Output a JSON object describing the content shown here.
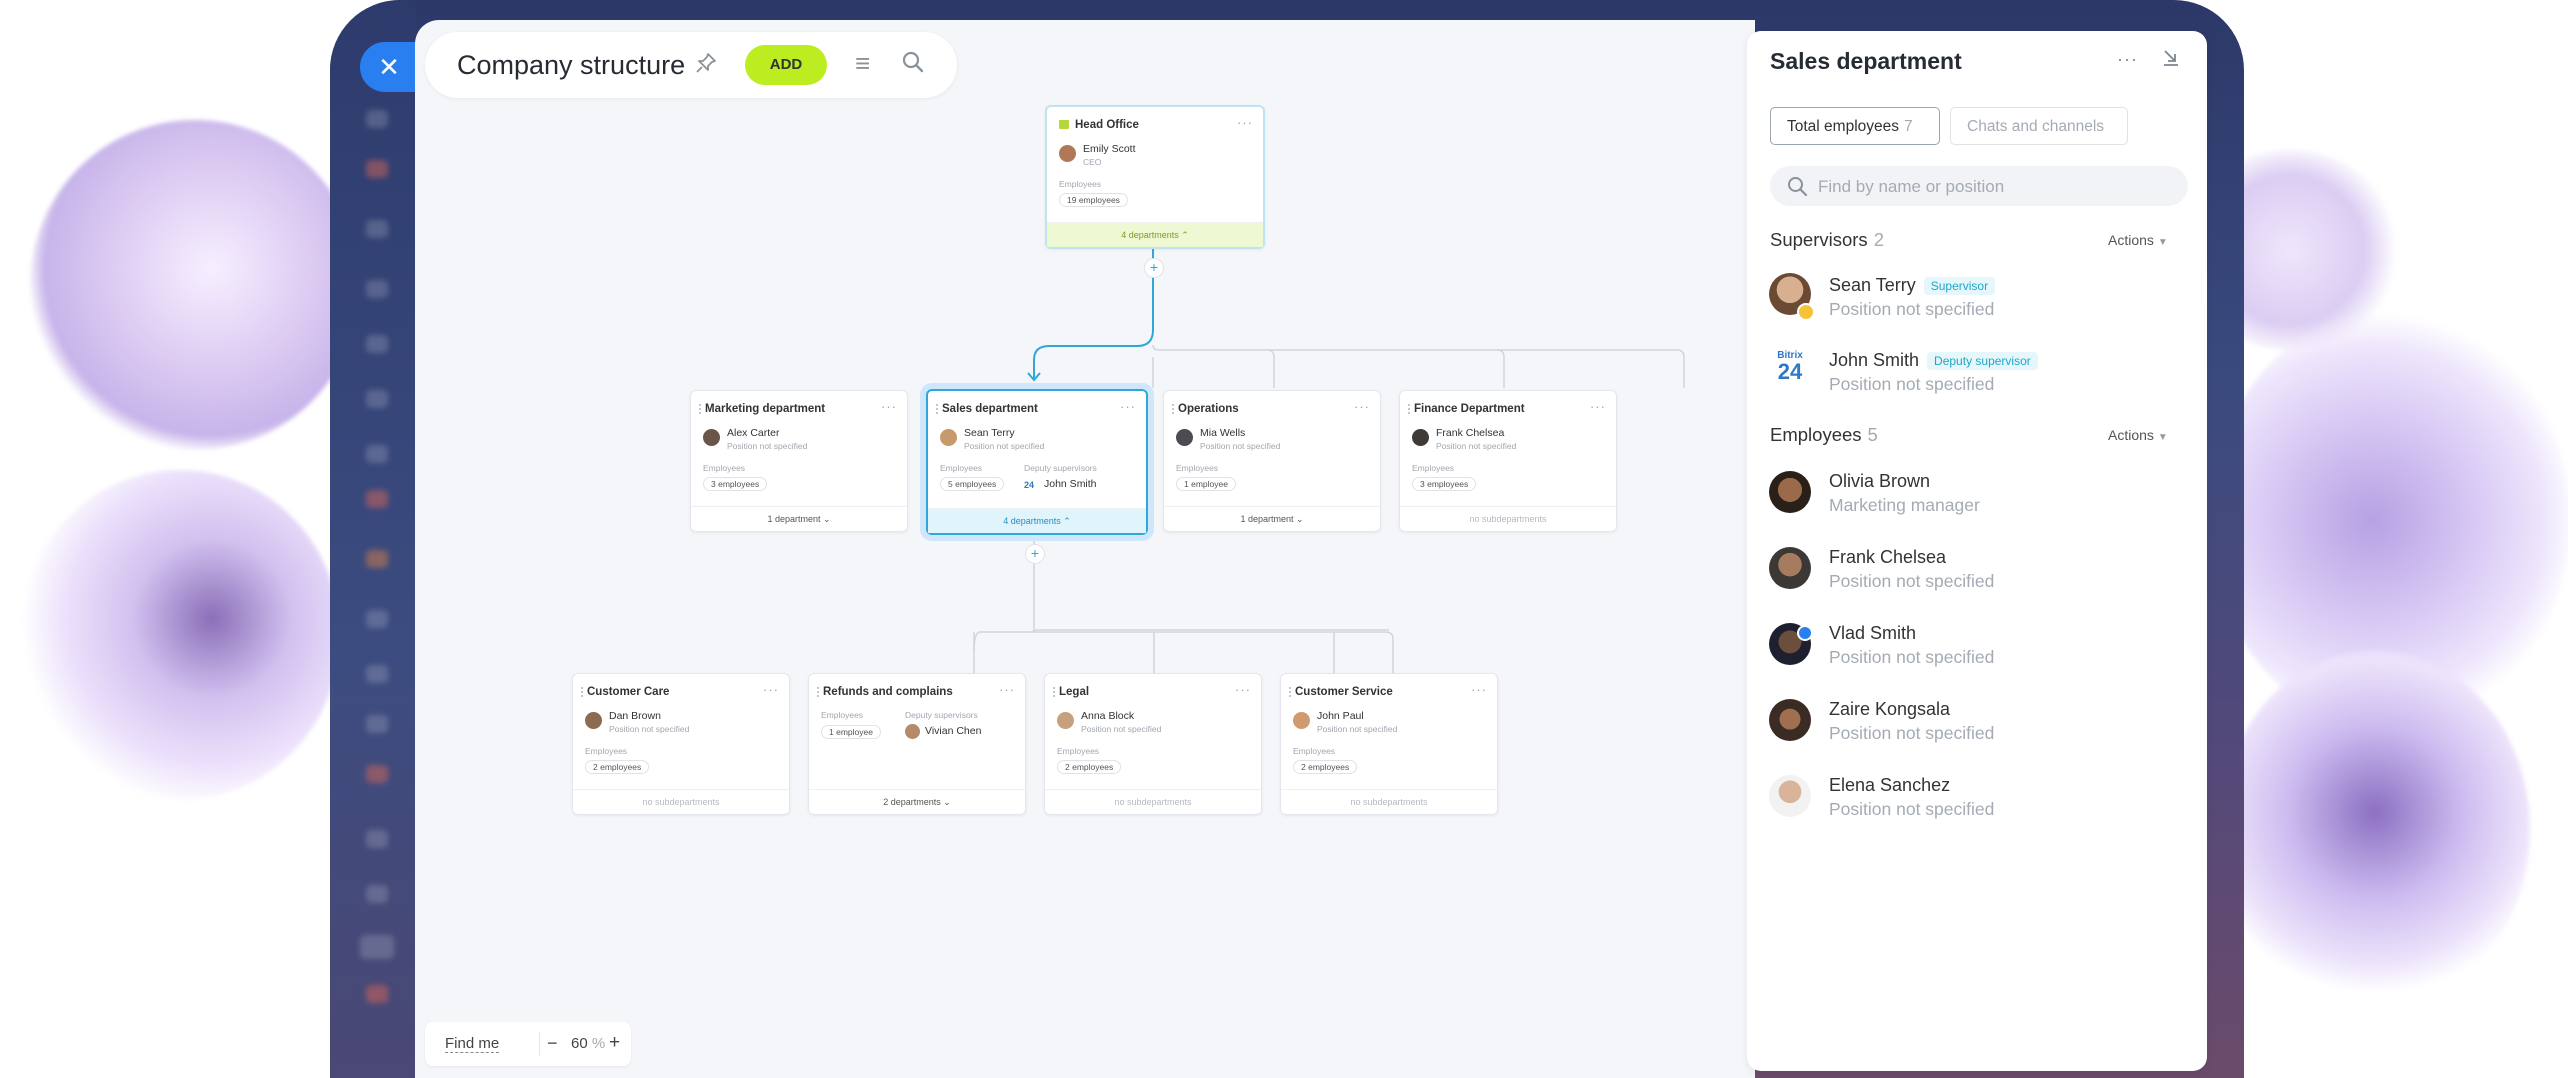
{
  "toolbar": {
    "title": "Company structure",
    "add_label": "ADD"
  },
  "zoom_control": {
    "find_me": "Find me",
    "zoom_value": "60",
    "zoom_unit": "%",
    "minus": "−",
    "plus": "+"
  },
  "org": {
    "head": {
      "name": "Head Office",
      "person": "Emily Scott",
      "role": "CEO",
      "employees_label": "Employees",
      "employees": "19 employees",
      "footer": "4 departments"
    },
    "level1": [
      {
        "name": "Marketing department",
        "person": "Alex Carter",
        "role": "Position not specified",
        "employees_label": "Employees",
        "employees": "3 employees",
        "footer": "1 department"
      },
      {
        "name": "Sales department",
        "person": "Sean Terry",
        "role": "Position not specified",
        "employees_label": "Employees",
        "employees": "5 employees",
        "deputy_label": "Deputy supervisors",
        "deputy": "John Smith",
        "footer": "4 departments"
      },
      {
        "name": "Operations",
        "person": "Mia Wells",
        "role": "Position not specified",
        "employees_label": "Employees",
        "employees": "1 employee",
        "footer": "1 department"
      },
      {
        "name": "Finance Department",
        "person": "Frank Chelsea",
        "role": "Position not specified",
        "employees_label": "Employees",
        "employees": "3 employees",
        "footer": "no subdepartments"
      }
    ],
    "level2": [
      {
        "name": "Customer Care",
        "person": "Dan Brown",
        "role": "Position not specified",
        "employees_label": "Employees",
        "employees": "2 employees",
        "footer": "no subdepartments"
      },
      {
        "name": "Refunds and complains",
        "employees_label": "Employees",
        "employees": "1 employee",
        "deputy_label": "Deputy supervisors",
        "deputy": "Vivian Chen",
        "footer": "2 departments"
      },
      {
        "name": "Legal",
        "person": "Anna Block",
        "role": "Position not specified",
        "employees_label": "Employees",
        "employees": "2 employees",
        "footer": "no subdepartments"
      },
      {
        "name": "Customer Service",
        "person": "John Paul",
        "role": "Position not specified",
        "employees_label": "Employees",
        "employees": "2 employees",
        "footer": "no subdepartments"
      }
    ]
  },
  "panel": {
    "title": "Sales department",
    "tabs": [
      {
        "label": "Total employees",
        "count": "7"
      },
      {
        "label": "Chats and channels"
      }
    ],
    "search_placeholder": "Find by name or position",
    "supervisors": {
      "label": "Supervisors",
      "count": "2",
      "actions": "Actions",
      "items": [
        {
          "name": "Sean Terry",
          "badge": "Supervisor",
          "position": "Position not specified"
        },
        {
          "name": "John Smith",
          "badge": "Deputy supervisor",
          "position": "Position not specified",
          "logo_line1": "Bitrix",
          "logo_line2": "24"
        }
      ]
    },
    "employees": {
      "label": "Employees",
      "count": "5",
      "actions": "Actions",
      "items": [
        {
          "name": "Olivia Brown",
          "position": "Marketing manager"
        },
        {
          "name": "Frank Chelsea",
          "position": "Position not specified"
        },
        {
          "name": "Vlad Smith",
          "position": "Position not specified"
        },
        {
          "name": "Zaire Kongsala",
          "position": "Position not specified"
        },
        {
          "name": "Elena Sanchez",
          "position": "Position not specified"
        }
      ]
    }
  },
  "colors": {
    "accent_green": "#bbed21",
    "accent_blue": "#2a7ff0",
    "selected_border": "#2fa8d8"
  }
}
